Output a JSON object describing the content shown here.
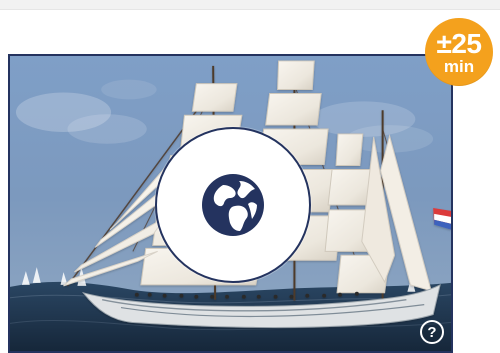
{
  "header": {
    "visible": true
  },
  "time_badge": {
    "value": "±25",
    "unit": "min",
    "color": "#F4A11D"
  },
  "hero": {
    "image_subject": "tall-ship",
    "border_color": "#24335F",
    "center_icon": "globe-icon",
    "help_icon": "help-icon",
    "help_label": "?"
  },
  "colors": {
    "navy": "#24335F",
    "white": "#FFFFFF",
    "sky": "#6D88AD",
    "orange": "#F4A11D"
  }
}
